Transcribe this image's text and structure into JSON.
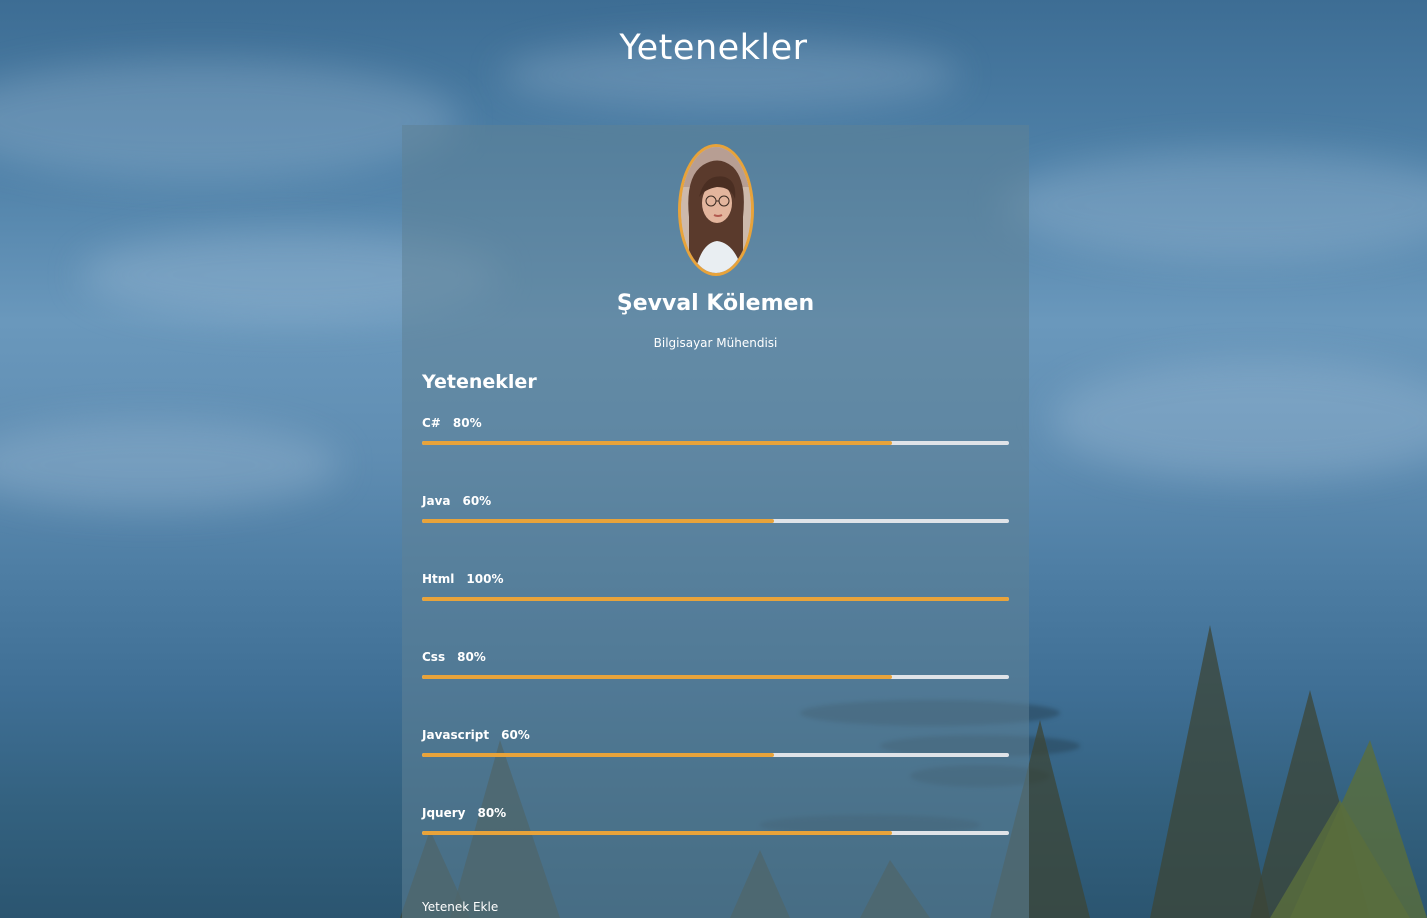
{
  "page": {
    "title": "Yetenekler"
  },
  "profile": {
    "name": "Şevval Kölemen",
    "role": "Bilgisayar Mühendisi"
  },
  "skills_section": {
    "title": "Yetenekler",
    "add_label": "Yetenek Ekle",
    "items": [
      {
        "name": "C#",
        "percent_label": "80%",
        "level": 0.8
      },
      {
        "name": "Java",
        "percent_label": "60%",
        "level": 0.6
      },
      {
        "name": "Html",
        "percent_label": "100%",
        "level": 1.0
      },
      {
        "name": "Css",
        "percent_label": "80%",
        "level": 0.8
      },
      {
        "name": "Javascript",
        "percent_label": "60%",
        "level": 0.6
      },
      {
        "name": "Jquery",
        "percent_label": "80%",
        "level": 0.8
      }
    ]
  },
  "colors": {
    "accent": "#e8a33a",
    "track": "#dfe3e8",
    "text": "#ffffff"
  }
}
